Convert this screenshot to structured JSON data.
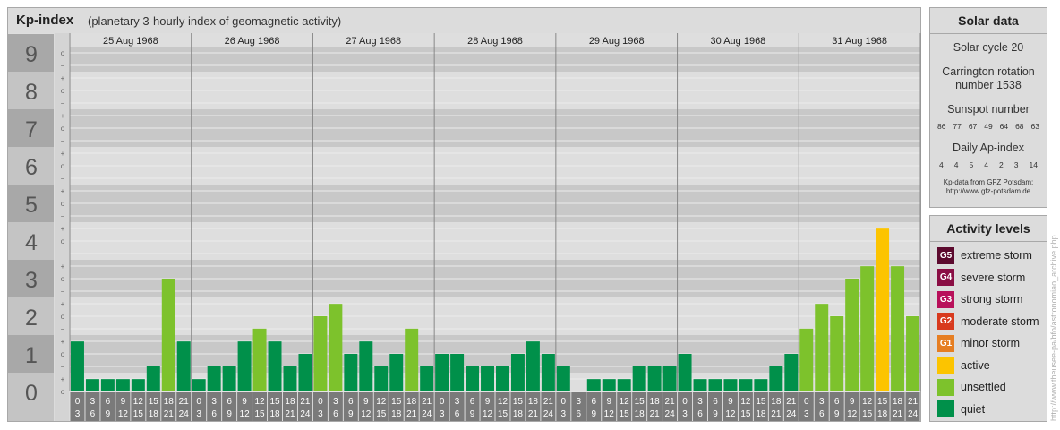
{
  "header": {
    "title": "Kp-index",
    "subtitle": "(planetary 3-hourly index of geomagnetic activity)"
  },
  "colors": {
    "quiet": "#00904a",
    "unsettled": "#7dc22c",
    "active": "#fcc400",
    "minor": "#e67e22",
    "moderate": "#d83a1e",
    "strong": "#b8105a",
    "severe": "#8a0e44",
    "extreme": "#5c0a2e"
  },
  "chart_data": {
    "type": "bar",
    "y_labels": [
      "0",
      "1",
      "2",
      "3",
      "4",
      "5",
      "6",
      "7",
      "8",
      "9"
    ],
    "y_sub_labels": [
      "o",
      "+",
      "−",
      "o"
    ],
    "ylim": [
      0,
      9.33
    ],
    "days": [
      "25 Aug 1968",
      "26 Aug 1968",
      "27 Aug 1968",
      "28 Aug 1968",
      "29 Aug 1968",
      "30 Aug 1968",
      "31 Aug 1968"
    ],
    "intervals": [
      [
        "0",
        "3"
      ],
      [
        "3",
        "6"
      ],
      [
        "6",
        "9"
      ],
      [
        "9",
        "12"
      ],
      [
        "12",
        "15"
      ],
      [
        "15",
        "18"
      ],
      [
        "18",
        "21"
      ],
      [
        "21",
        "24"
      ]
    ],
    "values": [
      [
        1.33,
        0.33,
        0.33,
        0.33,
        0.33,
        0.67,
        3.0,
        1.33
      ],
      [
        0.33,
        0.67,
        0.67,
        1.33,
        1.67,
        1.33,
        0.67,
        1.0
      ],
      [
        2.0,
        2.33,
        1.0,
        1.33,
        0.67,
        1.0,
        1.67,
        0.67
      ],
      [
        1.0,
        1.0,
        0.67,
        0.67,
        0.67,
        1.0,
        1.33,
        1.0
      ],
      [
        0.67,
        0.0,
        0.33,
        0.33,
        0.33,
        0.67,
        0.67,
        0.67
      ],
      [
        1.0,
        0.33,
        0.33,
        0.33,
        0.33,
        0.33,
        0.67,
        1.0
      ],
      [
        1.67,
        2.33,
        2.0,
        3.0,
        3.33,
        4.33,
        3.33,
        2.0
      ]
    ]
  },
  "solar": {
    "title": "Solar data",
    "cycle": "Solar cycle 20",
    "carrington_1": "Carrington rotation",
    "carrington_2": "number 1538",
    "sunspot_title": "Sunspot number",
    "sunspots": [
      "86",
      "77",
      "67",
      "49",
      "64",
      "68",
      "63"
    ],
    "ap_title": "Daily Ap-index",
    "ap": [
      "4",
      "4",
      "5",
      "4",
      "2",
      "3",
      "14"
    ],
    "source_1": "Kp-data from GFZ Potsdam:",
    "source_2": "http://www.gfz-potsdam.de"
  },
  "activity": {
    "title": "Activity levels",
    "items": [
      {
        "code": "G5",
        "label": "extreme storm",
        "color": "#5c0a2e"
      },
      {
        "code": "G4",
        "label": "severe storm",
        "color": "#8a0e44"
      },
      {
        "code": "G3",
        "label": "strong storm",
        "color": "#b8105a"
      },
      {
        "code": "G2",
        "label": "moderate storm",
        "color": "#d83a1e"
      },
      {
        "code": "G1",
        "label": "minor storm",
        "color": "#e67e22"
      },
      {
        "code": "",
        "label": "active",
        "color": "#fcc400"
      },
      {
        "code": "",
        "label": "unsettled",
        "color": "#7dc22c"
      },
      {
        "code": "",
        "label": "quiet",
        "color": "#00904a"
      }
    ]
  },
  "watermark": "http://www.theusee-pa/bfo/astronomiao_archive.php"
}
